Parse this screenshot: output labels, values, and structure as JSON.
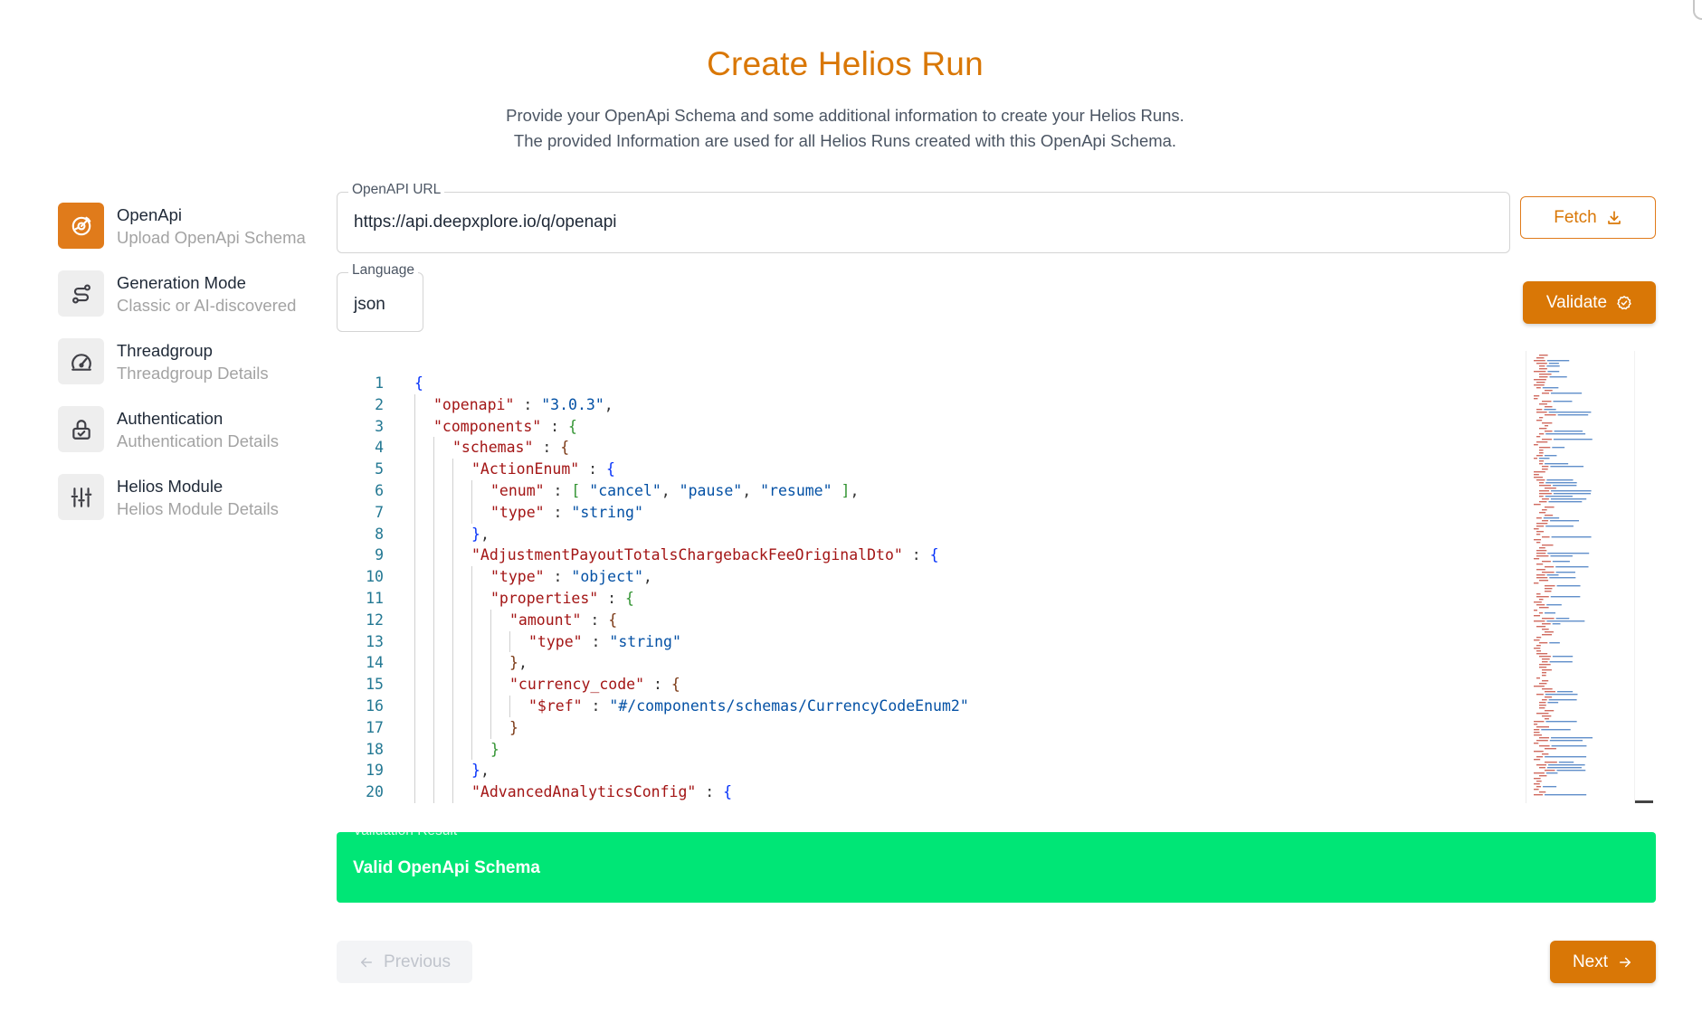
{
  "header": {
    "title": "Create Helios Run",
    "subtitle_line1": "Provide your OpenApi Schema and some additional information to create your Helios Runs.",
    "subtitle_line2": "The provided Information are used for all Helios Runs created with this OpenApi Schema."
  },
  "stepper": {
    "steps": [
      {
        "title": "OpenApi",
        "subtitle": "Upload OpenApi Schema",
        "icon": "openapi-icon",
        "active": true
      },
      {
        "title": "Generation Mode",
        "subtitle": "Classic or AI-discovered",
        "icon": "route-icon",
        "active": false
      },
      {
        "title": "Threadgroup",
        "subtitle": "Threadgroup Details",
        "icon": "gauge-icon",
        "active": false
      },
      {
        "title": "Authentication",
        "subtitle": "Authentication Details",
        "icon": "lock-check-icon",
        "active": false
      },
      {
        "title": "Helios Module",
        "subtitle": "Helios Module Details",
        "icon": "sliders-icon",
        "active": false
      }
    ]
  },
  "form": {
    "url_label": "OpenAPI URL",
    "url_value": "https://api.deepxplore.io/q/openapi",
    "language_label": "Language",
    "language_value": "json",
    "fetch_label": "Fetch",
    "validate_label": "Validate"
  },
  "editor": {
    "line_numbers": [
      "1",
      "2",
      "3",
      "4",
      "5",
      "6",
      "7",
      "8",
      "9",
      "10",
      "11",
      "12",
      "13",
      "14",
      "15",
      "16",
      "17",
      "18",
      "19",
      "20"
    ]
  },
  "validation": {
    "label": "Validation Result",
    "message": "Valid OpenApi Schema"
  },
  "nav": {
    "previous_label": "Previous",
    "next_label": "Next"
  },
  "colors": {
    "accent": "#d97706",
    "success": "#00e676"
  }
}
